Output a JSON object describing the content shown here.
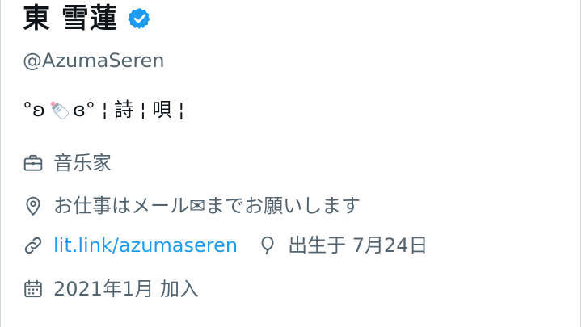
{
  "profile": {
    "display_name": "東 雪蓮",
    "handle": "@AzumaSeren",
    "bio_prefix": "°ʚ",
    "bio_suffix": "ɞ° ¦ 詩 ¦ 唄 ¦",
    "profession": "音乐家",
    "location": "お仕事はメール✉までお願いします",
    "website": "lit.link/azumaseren",
    "birthday": "出生于 7月24日",
    "joined": "2021年1月 加入"
  },
  "icons": {
    "verified": "verified-badge-icon",
    "bio_emoji": "baby-bottle-icon",
    "profession": "briefcase-icon",
    "location": "location-pin-icon",
    "website": "link-icon",
    "birthday": "balloon-icon",
    "joined": "calendar-icon"
  },
  "colors": {
    "accent": "#1d9bf0",
    "text": "#0f1419",
    "secondary": "#536471"
  }
}
